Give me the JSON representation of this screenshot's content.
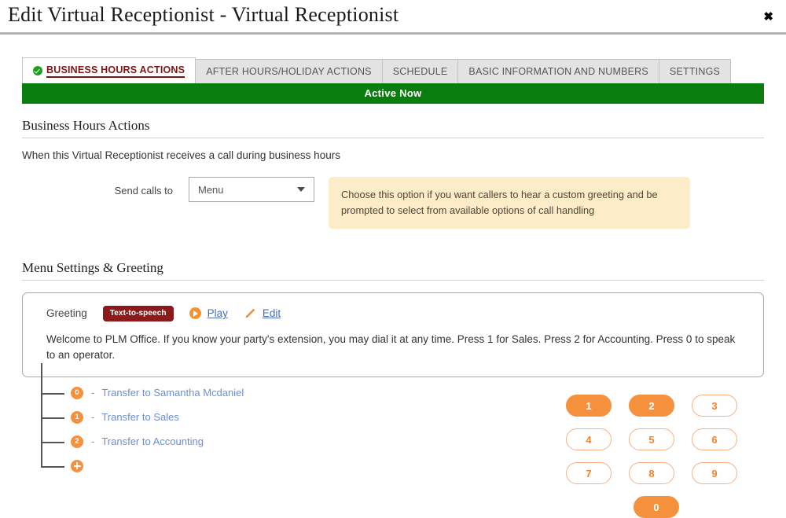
{
  "header": {
    "title": "Edit Virtual Receptionist - Virtual Receptionist",
    "close_label": "✖"
  },
  "tabs": [
    {
      "label": "BUSINESS HOURS ACTIONS",
      "active": true,
      "icon": "check-circle-icon"
    },
    {
      "label": "AFTER HOURS/HOLIDAY ACTIONS",
      "active": false
    },
    {
      "label": "SCHEDULE",
      "active": false
    },
    {
      "label": "BASIC INFORMATION AND NUMBERS",
      "active": false
    },
    {
      "label": "SETTINGS",
      "active": false
    }
  ],
  "status_banner": {
    "text": "Active Now",
    "color": "#0a7d0f"
  },
  "business_hours": {
    "section_title": "Business Hours Actions",
    "description": "When this Virtual Receptionist receives a call during business hours",
    "send_calls_label": "Send calls to",
    "send_calls_value": "Menu",
    "info_text": "Choose this option if you want callers to hear a custom greeting and be prompted to select from available options of call handling"
  },
  "menu_settings": {
    "section_title": "Menu Settings & Greeting",
    "greeting_label": "Greeting",
    "greeting_type_badge": "Text-to-speech",
    "play_label": "Play",
    "edit_label": "Edit",
    "greeting_text": "Welcome to PLM Office. If you know your party's extension, you may dial it at any time. Press 1 for Sales. Press 2 for Accounting. Press 0 to speak to an operator."
  },
  "menu_tree": {
    "separator": "-",
    "items": [
      {
        "key": "0",
        "action": "Transfer to Samantha Mcdaniel"
      },
      {
        "key": "1",
        "action": "Transfer to Sales"
      },
      {
        "key": "2",
        "action": "Transfer to Accounting"
      }
    ],
    "add_label": "+"
  },
  "keypad": {
    "rows": [
      [
        {
          "digit": "1",
          "assigned": true
        },
        {
          "digit": "2",
          "assigned": true
        },
        {
          "digit": "3",
          "assigned": false
        }
      ],
      [
        {
          "digit": "4",
          "assigned": false
        },
        {
          "digit": "5",
          "assigned": false
        },
        {
          "digit": "6",
          "assigned": false
        }
      ],
      [
        {
          "digit": "7",
          "assigned": false
        },
        {
          "digit": "8",
          "assigned": false
        },
        {
          "digit": "9",
          "assigned": false
        }
      ],
      [
        {
          "digit": "0",
          "assigned": true
        }
      ]
    ]
  },
  "colors": {
    "accent_orange": "#f5913d",
    "active_green": "#0a7d0f",
    "tab_active_red": "#7d1515",
    "link_blue": "#6c8ed4",
    "info_bg": "#fdecc8"
  }
}
